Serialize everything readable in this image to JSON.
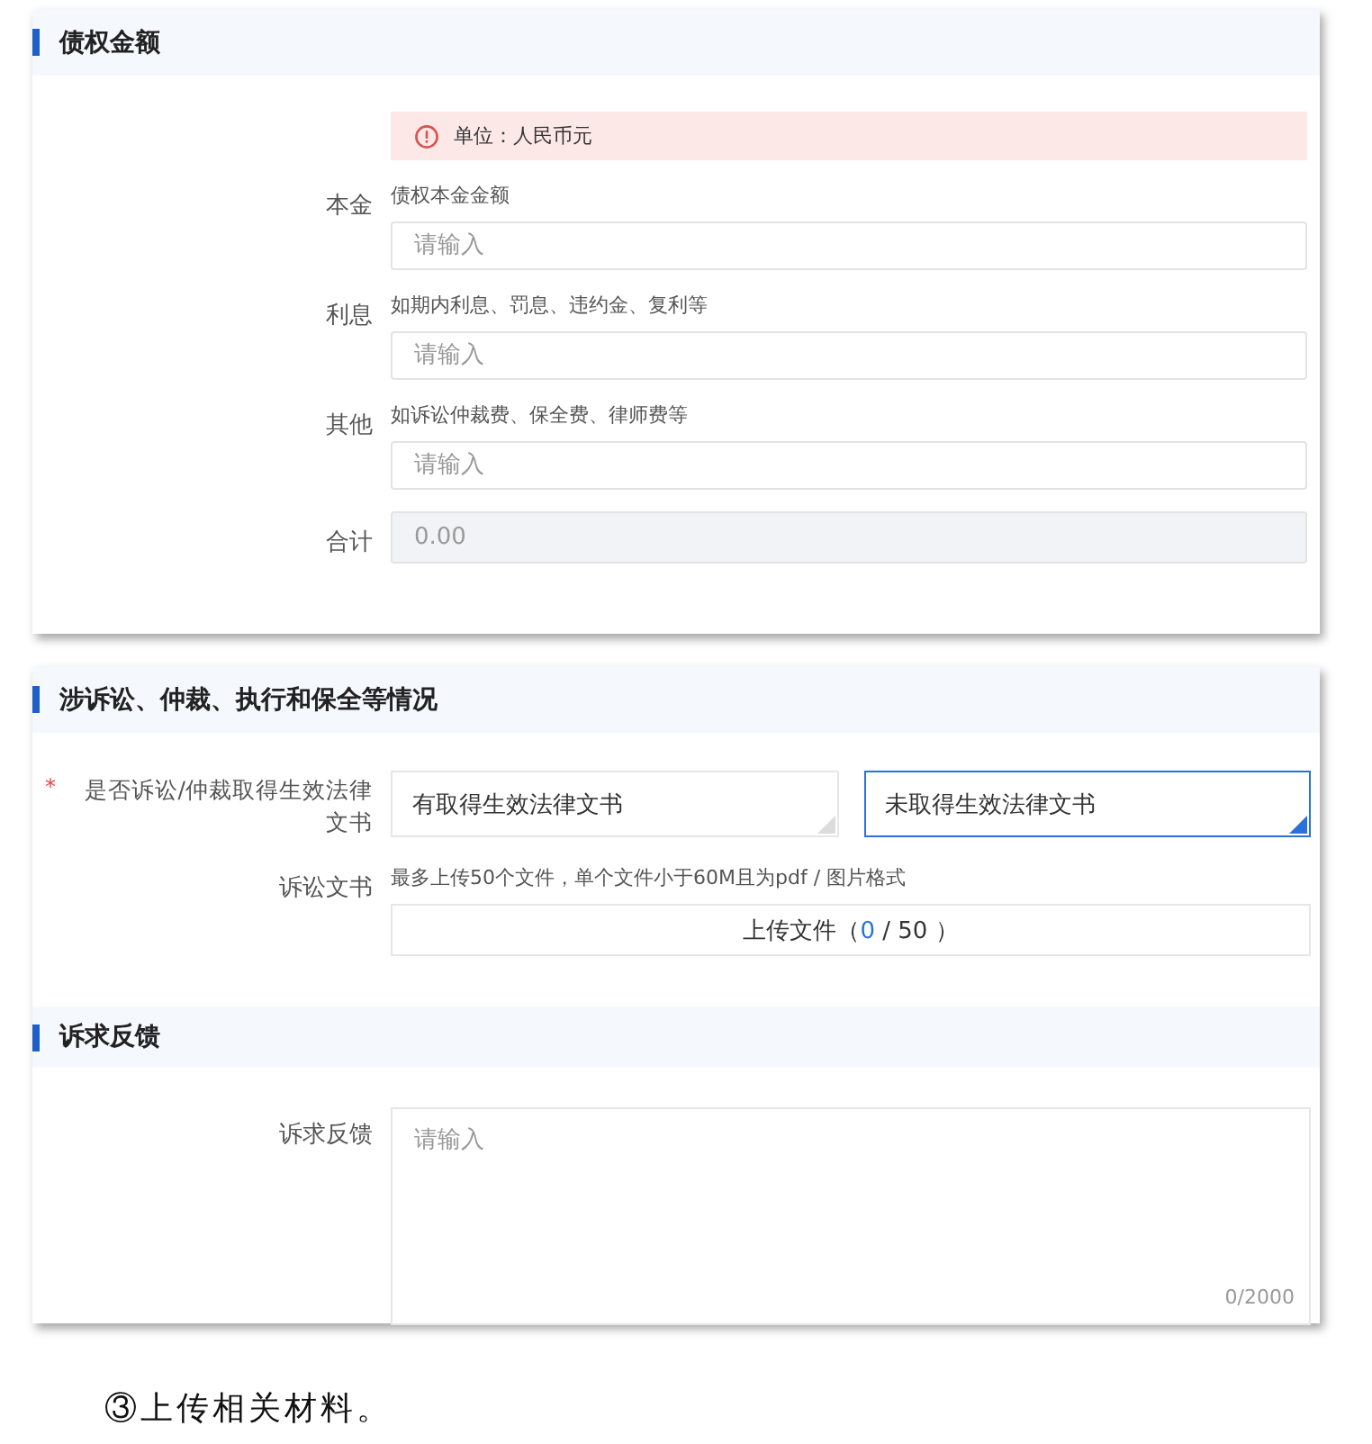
{
  "sections": [
    {
      "title": "债权金额",
      "notice": "单位：人民币元",
      "fields": [
        {
          "label": "本金",
          "hint": "债权本金金额",
          "placeholder": "请输入",
          "disabled": false
        },
        {
          "label": "利息",
          "hint": "如期内利息、罚息、违约金、复利等",
          "placeholder": "请输入",
          "disabled": false
        },
        {
          "label": "其他",
          "hint": "如诉讼仲裁费、保全费、律师费等",
          "placeholder": "请输入",
          "disabled": false
        },
        {
          "label": "合计",
          "placeholder": "0.00",
          "disabled": true
        }
      ]
    },
    {
      "title": "涉诉讼、仲裁、执行和保全等情况",
      "choice": {
        "required_mark": "*",
        "label": "是否诉讼/仲裁取得生效法律文书",
        "options": [
          {
            "label": "有取得生效法律文书",
            "selected": false
          },
          {
            "label": "未取得生效法律文书",
            "selected": true
          }
        ]
      },
      "upload": {
        "label": "诉讼文书",
        "hint": "最多上传50个文件，单个文件小于60M且为pdf / 图片格式",
        "prefix": "上传文件（",
        "count": "0",
        "suffix": " / 50 ）"
      }
    },
    {
      "title": "诉求反馈",
      "textarea": {
        "label": "诉求反馈",
        "placeholder": "请输入",
        "counter": "0/2000"
      }
    }
  ],
  "caption": "③上传相关材料。"
}
